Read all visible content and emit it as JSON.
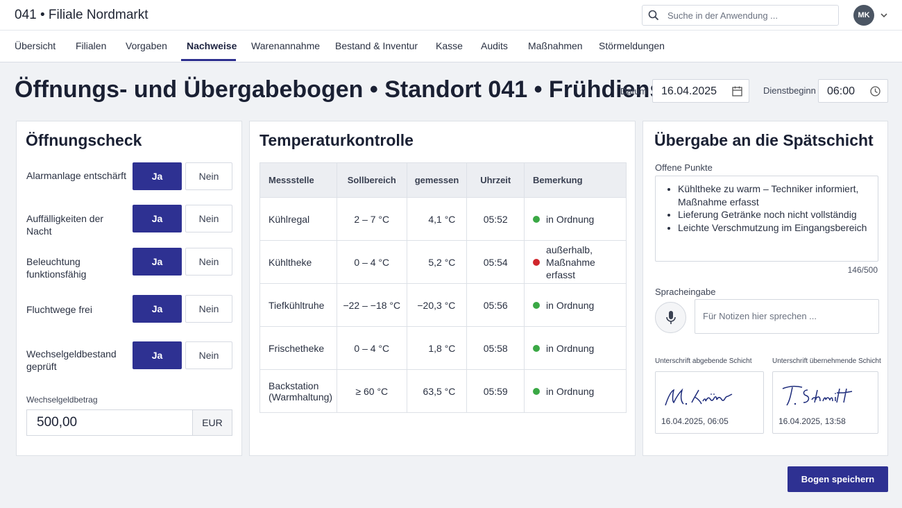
{
  "app": {
    "title": "041 • Filiale Nordmarkt"
  },
  "search": {
    "placeholder": "Suche in der Anwendung ..."
  },
  "user": {
    "initials": "MK"
  },
  "nav": {
    "tabs": [
      "Übersicht",
      "Filialen",
      "Vorgaben",
      "Nachweise",
      "Warenannahme",
      "Bestand & Inventur",
      "Kasse",
      "Audits",
      "Maßnahmen",
      "Störmeldungen"
    ],
    "active": "Nachweise"
  },
  "page": {
    "title": "Öffnungs- und Übergabebogen • Standort 041 • Frühdienst",
    "date_label": "Datum",
    "date_value": "16.04.2025",
    "shift_label": "Dienstbeginn",
    "shift_value": "06:00"
  },
  "opening": {
    "title": "Öffnungscheck",
    "yes_label": "Ja",
    "no_label": "Nein",
    "items": [
      {
        "label": "Alarmanlage entschärft",
        "selected": "Ja"
      },
      {
        "label": "Auffälligkeiten der Nacht",
        "selected": "Ja"
      },
      {
        "label": "Beleuchtung funktionsfähig",
        "selected": "Ja"
      },
      {
        "label": "Fluchtwege frei",
        "selected": "Ja"
      },
      {
        "label": "Wechselgeldbestand geprüft",
        "selected": "Ja"
      }
    ],
    "cash_label": "Wechselgeldbetrag",
    "cash_value": "500,00",
    "cash_unit": "EUR"
  },
  "temperature": {
    "title": "Temperaturkontrolle",
    "columns": [
      "Messstelle",
      "Sollbereich",
      "gemessen",
      "Uhrzeit",
      "Bemerkung"
    ],
    "rows": [
      {
        "point": "Kühlregal",
        "range": "2 – 7 °C",
        "measured": "4,1 °C",
        "time": "05:52",
        "remark": "in Ordnung",
        "status": "ok"
      },
      {
        "point": "Kühltheke",
        "range": "0 – 4 °C",
        "measured": "5,2 °C",
        "time": "05:54",
        "remark": "außerhalb, Maßnahme erfasst",
        "status": "alert"
      },
      {
        "point": "Tiefkühltruhe",
        "range": "−22 – −18 °C",
        "measured": "−20,3 °C",
        "time": "05:56",
        "remark": "in Ordnung",
        "status": "ok"
      },
      {
        "point": "Frischetheke",
        "range": "0 – 4 °C",
        "measured": "1,8 °C",
        "time": "05:58",
        "remark": "in Ordnung",
        "status": "ok"
      },
      {
        "point": "Backstation (Warmhaltung)",
        "range": "≥ 60 °C",
        "measured": "63,5 °C",
        "time": "05:59",
        "remark": "in Ordnung",
        "status": "ok"
      }
    ],
    "colors": {
      "ok": "#3aa845",
      "alert": "#d0262c"
    }
  },
  "handover": {
    "title": "Übergabe an die Spätschicht",
    "open_points_label": "Offene Punkte",
    "open_points": [
      "Kühltheke zu warm – Techniker informiert, Maßnahme erfasst",
      "Lieferung Getränke noch nicht vollständig",
      "Leichte Verschmutzung im Eingangsbereich"
    ],
    "counter": "146/500",
    "voice_label": "Spracheingabe",
    "voice_placeholder": "Für Notizen hier sprechen ...",
    "sig_out_label": "Unterschrift abgebende Schicht",
    "sig_out_name": "M. Krämer",
    "sig_out_date": "16.04.2025, 06:05",
    "sig_in_label": "Unterschrift übernehmende Schicht",
    "sig_in_name": "T. Schmitt",
    "sig_in_date": "16.04.2025, 13:58"
  },
  "actions": {
    "save": "Bogen speichern"
  },
  "theme": {
    "accent": "#2e3192"
  }
}
